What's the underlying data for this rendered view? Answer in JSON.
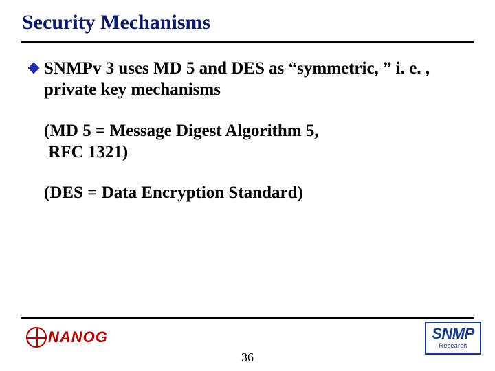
{
  "title": "Security Mechanisms",
  "bullet": {
    "main": "SNMPv 3 uses MD 5 and DES as “symmetric, ” i. e. , private key mechanisms",
    "sub1": "(MD 5 = Message Digest Algorithm 5,\n RFC 1321)",
    "sub2": "(DES = Data Encryption Standard)"
  },
  "page_number": "36",
  "logos": {
    "nanog": "NANOG",
    "snmp_main": "SNMP",
    "snmp_sub": "Research"
  },
  "colors": {
    "title": "#0b1a6b",
    "bullet_fill": "#1a2bb5",
    "nanog": "#b00000",
    "snmp": "#173a8a"
  }
}
